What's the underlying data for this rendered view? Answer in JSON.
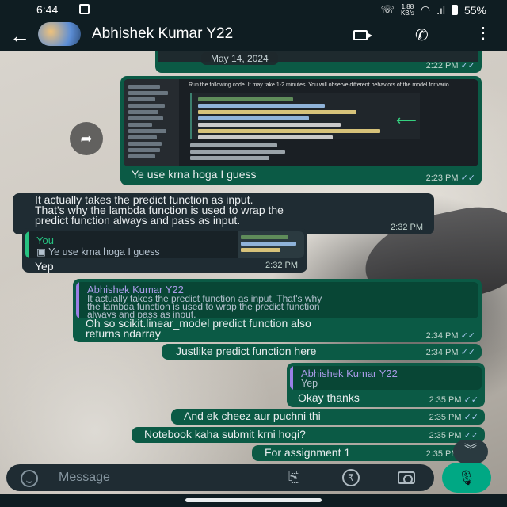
{
  "status_bar": {
    "time": "6:44",
    "speed_value": "1.88",
    "speed_unit": "KB/s",
    "battery": "55%"
  },
  "header": {
    "contact_name": "Abhishek Kumar Y22"
  },
  "messages": [
    {
      "id": "m0",
      "direction": "out",
      "date_label": "May 14, 2024",
      "time": "2:22 PM"
    },
    {
      "id": "m1",
      "direction": "out",
      "image_caption": "Run the following code. It may take 1-2 minutes. You will observe different behaviors of the model for vario",
      "text": "Ye use krna hoga I guess",
      "time": "2:23 PM"
    },
    {
      "id": "m2",
      "direction": "in",
      "text_line1": "It actually takes the predict function as input.",
      "text_line2": "That's why the lambda function is used to wrap the",
      "text_line3": "predict function always and pass as input.",
      "time": "2:32 PM"
    },
    {
      "id": "m3",
      "direction": "in",
      "quote_name": "You",
      "quote_text": "Ye use krna hoga I guess",
      "text": "Yep",
      "time": "2:32 PM"
    },
    {
      "id": "m4",
      "direction": "out",
      "quote_name": "Abhishek Kumar Y22",
      "quote_line1": "It actually takes the predict function as input. That's why",
      "quote_line2": "the lambda function is used to wrap the predict function",
      "quote_line3": "always and pass as input.",
      "text_line1": "Oh so scikit.linear_model predict function also",
      "text_line2": "returns ndarray",
      "time": "2:34 PM"
    },
    {
      "id": "m5",
      "direction": "out",
      "text": "Justlike predict function here",
      "time": "2:34 PM"
    },
    {
      "id": "m6",
      "direction": "out",
      "quote_name": "Abhishek Kumar Y22",
      "quote_text": "Yep",
      "text": "Okay thanks",
      "time": "2:35 PM"
    },
    {
      "id": "m7",
      "direction": "out",
      "text": "And ek cheez aur puchni thi",
      "time": "2:35 PM"
    },
    {
      "id": "m8",
      "direction": "out",
      "text": "Notebook kaha submit krni hogi?",
      "time": "2:35 PM"
    },
    {
      "id": "m9",
      "direction": "out",
      "text": "For assignment 1",
      "time": "2:35 PM"
    }
  ],
  "composer": {
    "placeholder": "Message"
  },
  "icons": {
    "back": "arrow-left",
    "video": "video-camera",
    "call": "phone",
    "more": "vertical-dots",
    "forward": "forward-arrow",
    "scroll": "chevron-double-down",
    "emoji": "smiley",
    "attach": "paperclip",
    "payment": "rupee",
    "camera": "camera",
    "mic": "microphone"
  },
  "colors": {
    "outgoing_bubble": "#0b5a45",
    "incoming_bubble": "#1f2c33",
    "accent": "#00a884",
    "read_ticks": "#a7c8f0"
  }
}
